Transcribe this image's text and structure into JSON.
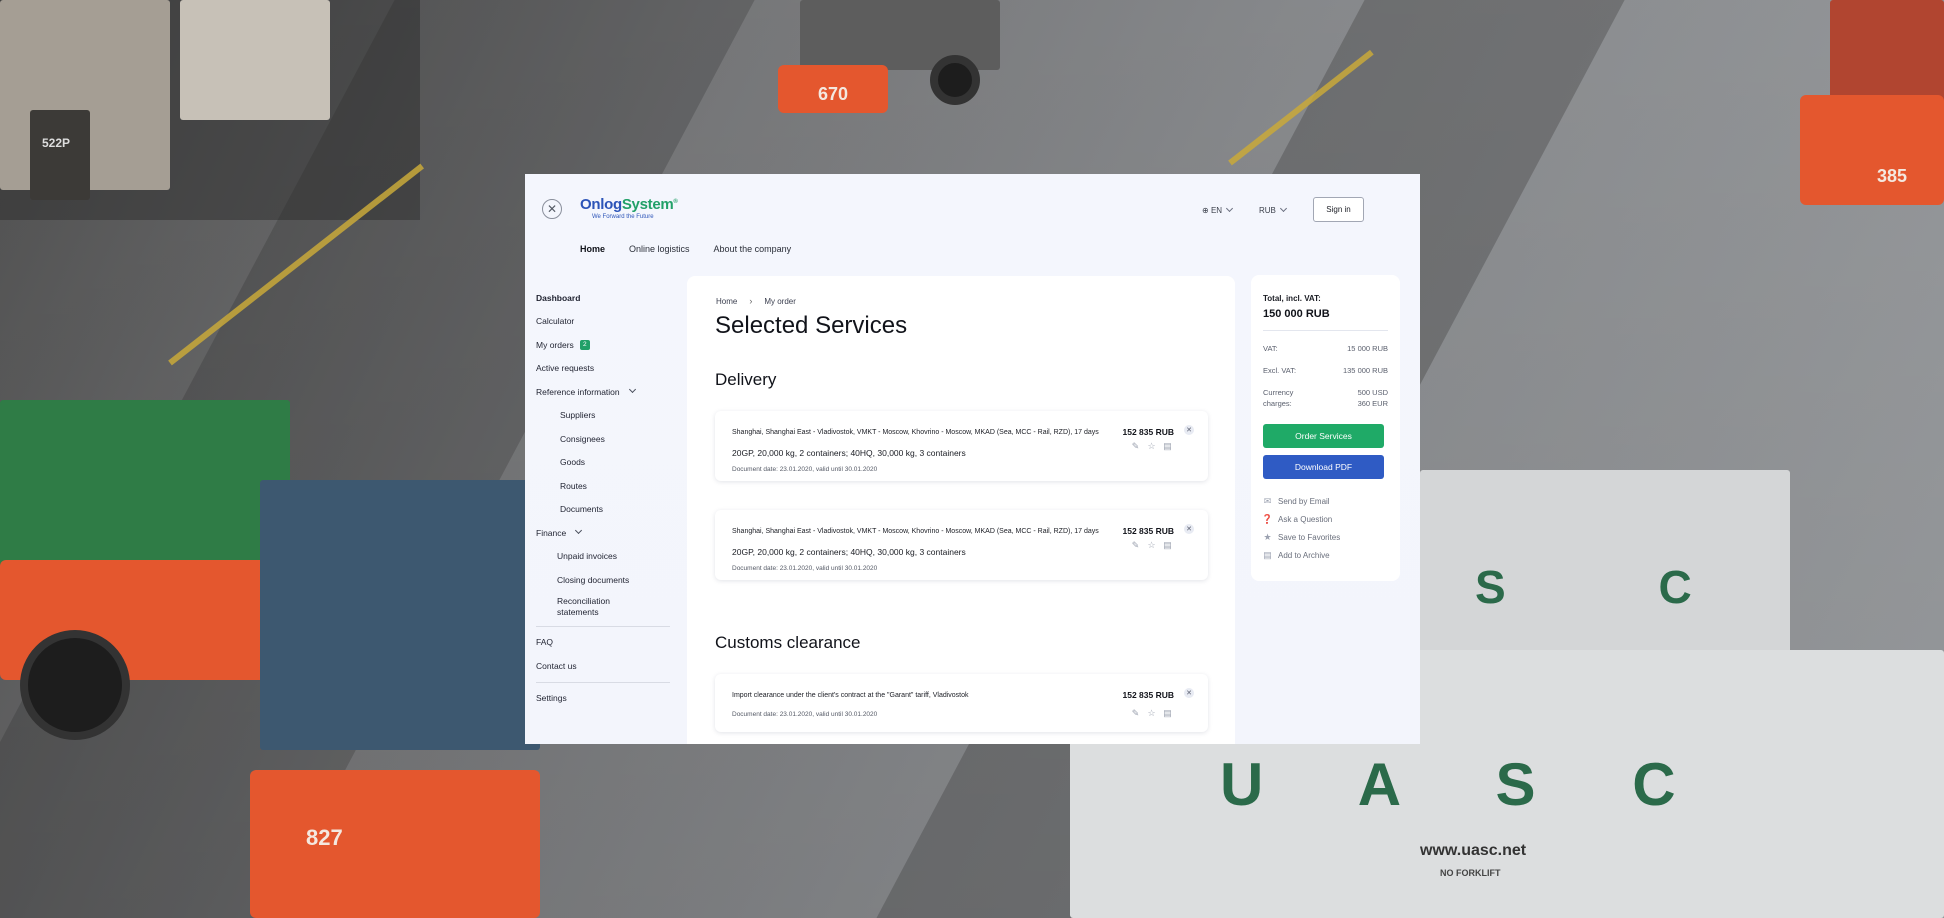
{
  "window": {
    "close_icon": "close-icon",
    "logo": {
      "part1": "Onlog",
      "part2": "System",
      "reg": "®",
      "tagline": "We Forward the Future"
    },
    "language": {
      "icon": "globe-icon",
      "value": "EN"
    },
    "currency": {
      "value": "RUB"
    },
    "signin_label": "Sign in",
    "nav": [
      {
        "label": "Home",
        "active": true
      },
      {
        "label": "Online logistics",
        "active": false
      },
      {
        "label": "About the company",
        "active": false
      }
    ]
  },
  "sidebar": {
    "dashboard": "Dashboard",
    "calculator": "Calculator",
    "my_orders": "My orders",
    "my_orders_count": "2",
    "active_requests": "Active requests",
    "reference_information": "Reference information",
    "reference_items": [
      "Suppliers",
      "Consignees",
      "Goods",
      "Routes",
      "Documents"
    ],
    "finance": "Finance",
    "finance_items": [
      "Unpaid invoices",
      "Closing documents",
      "Reconciliation statements"
    ],
    "faq": "FAQ",
    "contact": "Contact us",
    "settings": "Settings"
  },
  "content": {
    "breadcrumb": {
      "home": "Home",
      "separator": "›",
      "current": "My order"
    },
    "title": "Selected Services",
    "delivery_title": "Delivery",
    "customs_title": "Customs clearance",
    "delivery_cards": [
      {
        "route": "Shanghai, Shanghai East - Vladivostok, VMKT - Moscow, Khovrino - Moscow, MKAD (Sea, MCC - Rail, RZD), 17 days",
        "detail": "20GP, 20,000 kg, 2 containers; 40HQ, 30,000 kg, 3 containers",
        "doc_date": "Document date: 23.01.2020, valid until 30.01.2020",
        "price": "152 835 RUB"
      },
      {
        "route": "Shanghai, Shanghai East - Vladivostok, VMKT - Moscow, Khovrino - Moscow, MKAD (Sea, MCC - Rail, RZD), 17 days",
        "detail": "20GP, 20,000 kg, 2 containers; 40HQ, 30,000 kg, 3 containers",
        "doc_date": "Document date: 23.01.2020, valid until 30.01.2020",
        "price": "152 835 RUB"
      }
    ],
    "customs_cards": [
      {
        "route": "Import clearance under the client's contract at the \"Garant\" tariff, Vladivostok",
        "doc_date": "Document date: 23.01.2020, valid until 30.01.2020",
        "price": "152 835 RUB"
      }
    ]
  },
  "summary": {
    "total_label": "Total, incl. VAT:",
    "total_value": "150 000 RUB",
    "vat_label": "VAT:",
    "vat_value": "15 000 RUB",
    "excl_label": "Excl. VAT:",
    "excl_value": "135 000 RUB",
    "currency_label": "Currency charges:",
    "currency_value_1": "500 USD",
    "currency_value_2": "360 EUR",
    "order_button": "Order Services",
    "download_button": "Download PDF",
    "links": [
      {
        "label": "Send by Email",
        "icon": "mail-icon"
      },
      {
        "label": "Ask a Question",
        "icon": "question-icon"
      },
      {
        "label": "Save to Favorites",
        "icon": "star-icon"
      },
      {
        "label": "Add to Archive",
        "icon": "archive-icon"
      }
    ]
  },
  "background": {
    "labels": [
      "522P",
      "670",
      "385",
      "827",
      "U A S C",
      "S C",
      "www.uasc.net",
      "NO FORKLIFT"
    ]
  },
  "colors": {
    "brand_blue": "#2c54b8",
    "brand_green": "#21a068",
    "order_button": "#1faa67",
    "download_button": "#2f5bc4"
  }
}
